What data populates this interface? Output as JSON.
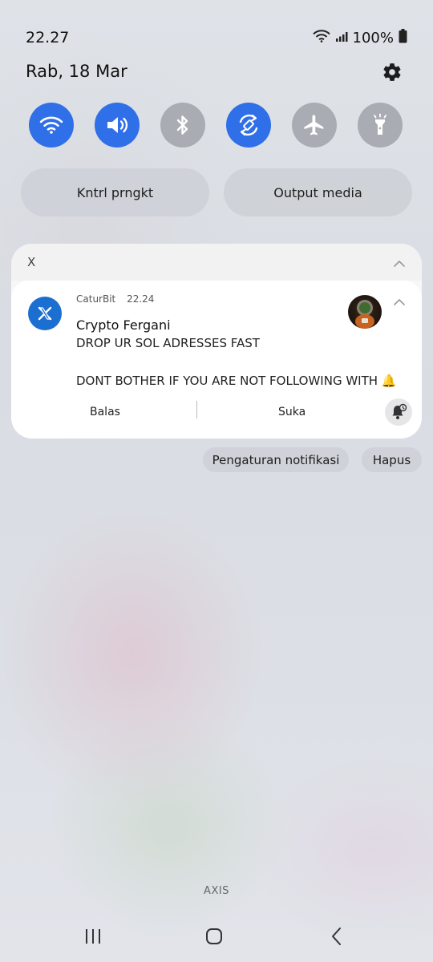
{
  "status_bar": {
    "time": "22.27",
    "battery": "100%",
    "icons": [
      "wifi-icon",
      "signal-icon",
      "battery-icon"
    ]
  },
  "header": {
    "date": "Rab, 18 Mar",
    "settings_icon": "gear-icon"
  },
  "quick_toggles": [
    {
      "name": "wifi",
      "icon": "wifi-icon",
      "active": true
    },
    {
      "name": "sound",
      "icon": "speaker-icon",
      "active": true
    },
    {
      "name": "bluetooth",
      "icon": "bluetooth-icon",
      "active": false
    },
    {
      "name": "auto-rotate",
      "icon": "rotate-icon",
      "active": true
    },
    {
      "name": "airplane-mode",
      "icon": "airplane-icon",
      "active": false
    },
    {
      "name": "flashlight",
      "icon": "flashlight-icon",
      "active": false
    }
  ],
  "quick_buttons": {
    "device_control": "Kntrl prngkt",
    "media_output": "Output media"
  },
  "notification": {
    "group_app": "X",
    "sender_app": "CaturBit",
    "time": "22.24",
    "title": "Crypto Fergani",
    "line1": "DROP UR SOL ADRESSES FAST",
    "line2": "DONT BOTHER IF YOU ARE NOT FOLLOWING WITH 🔔",
    "actions": {
      "reply": "Balas",
      "like": "Suka"
    }
  },
  "notification_footer": {
    "settings": "Pengaturan notifikasi",
    "clear": "Hapus"
  },
  "carrier": "AXIS",
  "colors": {
    "accent": "#2f6fe8",
    "inactive": "#a9adb3",
    "x_icon_bg": "#1b6fd0"
  }
}
